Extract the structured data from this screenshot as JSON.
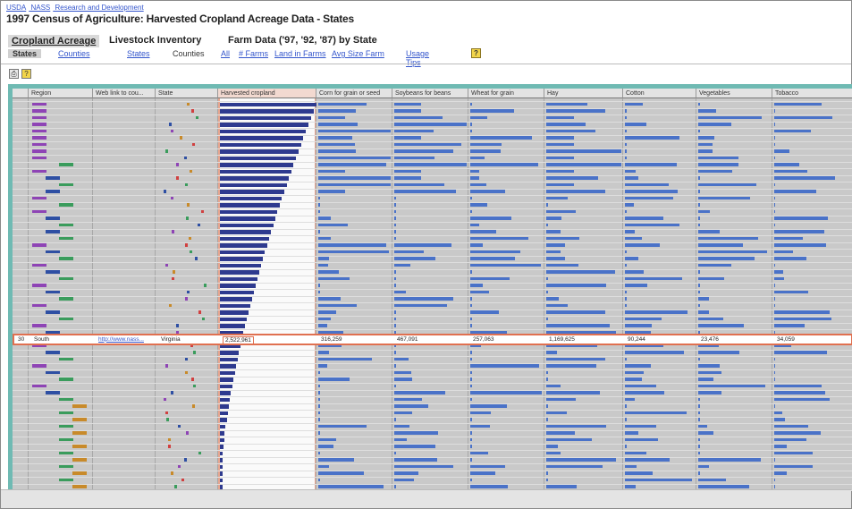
{
  "header": {
    "breadcrumb": [
      "USDA",
      "NASS",
      "Research and Development"
    ],
    "title": "1997 Census of Agriculture: Harvested Cropland Acreage Data - States"
  },
  "tabs": {
    "primary": [
      "Cropland Acreage",
      "Livestock Inventory",
      "Farm Data ('97, '92, '87) by State"
    ],
    "secondary_left": [
      "States",
      "Counties"
    ],
    "secondary_mid": [
      "States",
      "Counties"
    ],
    "secondary_links": [
      "All",
      "# Farms",
      "Land in Farms",
      "Avg Size Farm"
    ],
    "usage_tips": "Usage Tips",
    "help": "?"
  },
  "toolbar": {
    "tool1": "⎙",
    "tool2": "?"
  },
  "grid": {
    "columns": [
      "Region",
      "Web link to cou...",
      "State",
      "Harvested cropland",
      "Corn for grain or seed",
      "Soybeans for beans",
      "Wheat for grain",
      "Hay",
      "Cotton",
      "Vegetables",
      "Tobacco"
    ],
    "selected_row": {
      "index": "30",
      "region": "South",
      "web_link": "http://www.nass...",
      "state": "Virginia",
      "harvested_cropland": "2,522,961",
      "corn": "316,259",
      "soybeans": "467,091",
      "wheat": "257,063",
      "hay": "1,169,625",
      "cotton": "90,244",
      "vegetables": "23,476",
      "tobacco": "34,059"
    },
    "colors": {
      "region_1": "#8e44b5",
      "region_2": "#2e4fa3",
      "region_3": "#3a9c5c",
      "region_4": "#c88a2a",
      "harvested": "#2e3a8f",
      "crop": "#4a72c8",
      "selection": "#e07050",
      "frame": "#6fbab3"
    }
  }
}
